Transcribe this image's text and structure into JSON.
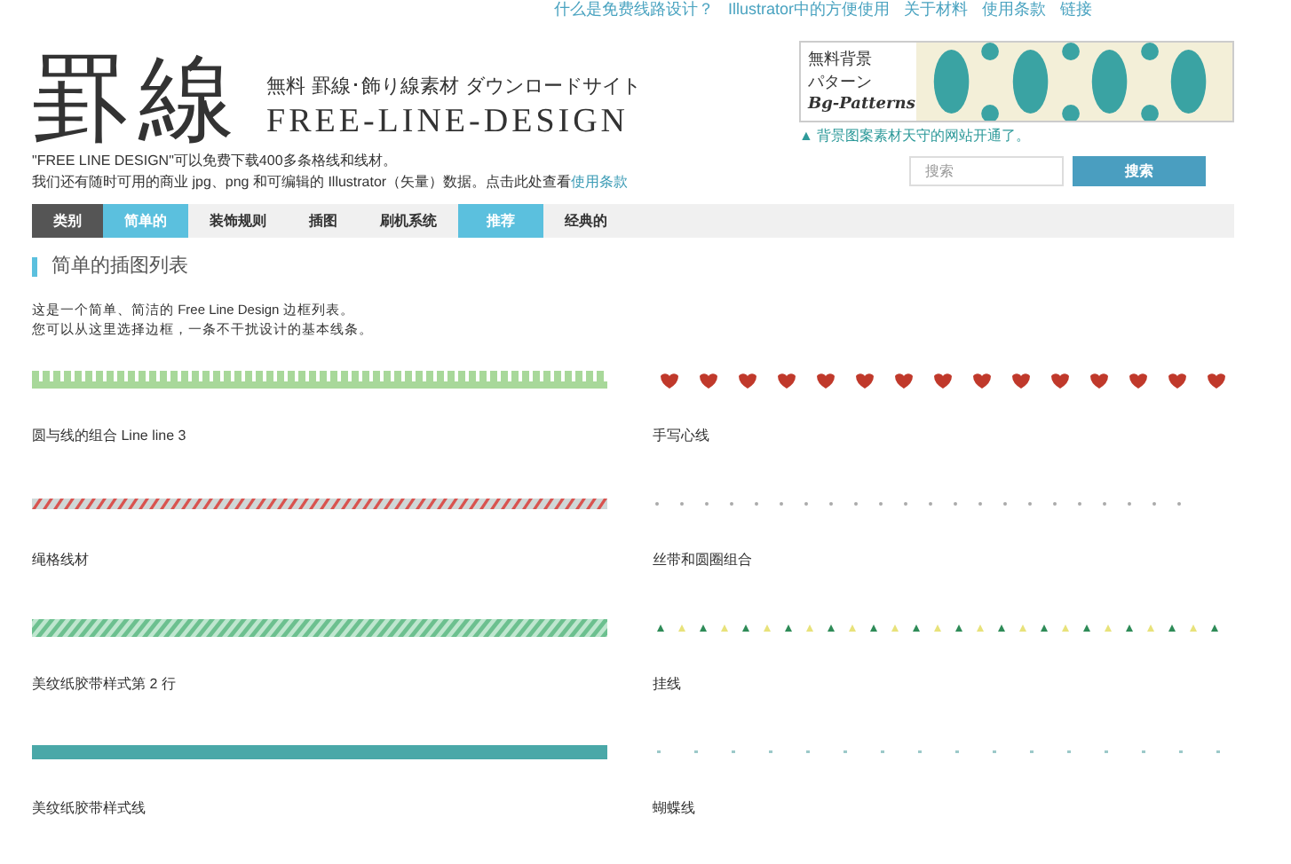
{
  "top_links": [
    "什么是免费线路设计？",
    "Illustrator中的方便使用",
    "关于材料",
    "使用条款",
    "链接"
  ],
  "logo": {
    "title": "罫線",
    "tagline": "無料 罫線･飾り線素材 ダウンロードサイト",
    "subtitle": "FREE-LINE-DESIGN"
  },
  "intro": {
    "line_1": "\"FREE LINE DESIGN\"可以免费下载400多条格线和线材。",
    "line_2": "我们还有随时可用的商业 jpg、png 和可编辑的 Illustrator（矢量）数据。点击此处查看",
    "link": "使用条款"
  },
  "banner": {
    "lines": [
      "無料背景",
      "パターン",
      "Bg-Patterns"
    ],
    "caption": "▲ 背景图案素材天守的网站开通了。"
  },
  "search": {
    "placeholder": "搜索",
    "button": "搜索"
  },
  "nav": [
    {
      "label": "类别",
      "kind": "heading"
    },
    {
      "label": "简单的",
      "kind": "tab",
      "selected": true
    },
    {
      "label": "装饰规则",
      "kind": "tab",
      "selected": false
    },
    {
      "label": "插图",
      "kind": "tab",
      "selected": false
    },
    {
      "label": "刷机系统",
      "kind": "tab",
      "selected": false
    },
    {
      "label": "推荐",
      "kind": "tab",
      "selected": true
    },
    {
      "label": "经典的",
      "kind": "tab",
      "selected": false
    }
  ],
  "section": {
    "title": "简单的插图列表",
    "description_1": "这是一个简单、简洁的 Free Line Design 边框列表。",
    "description_2": "您可以从这里选择边框，一条不干扰设计的基本线条。"
  },
  "lines": [
    {
      "name": "圆与线的组合 Line line 3",
      "kind": "comb",
      "color": "#a8d89a"
    },
    {
      "name": "手写心线",
      "kind": "hearts",
      "color": "#c0392b"
    },
    {
      "name": "绳格线材",
      "kind": "candy",
      "color": "#d9534f"
    },
    {
      "name": "丝带和圆圈组合",
      "kind": "dots",
      "color": "#aaaaaa"
    },
    {
      "name": "美纹纸胶带样式第 2 行",
      "kind": "stripes",
      "color": "#6cc08f"
    },
    {
      "name": "挂线",
      "kind": "lights",
      "color": "#2e8b57"
    },
    {
      "name": "美纹纸胶带样式线",
      "kind": "tape",
      "color": "#4aa8a8"
    },
    {
      "name": "蝴蝶线",
      "kind": "sparse",
      "color": "#9cc9c9"
    }
  ]
}
